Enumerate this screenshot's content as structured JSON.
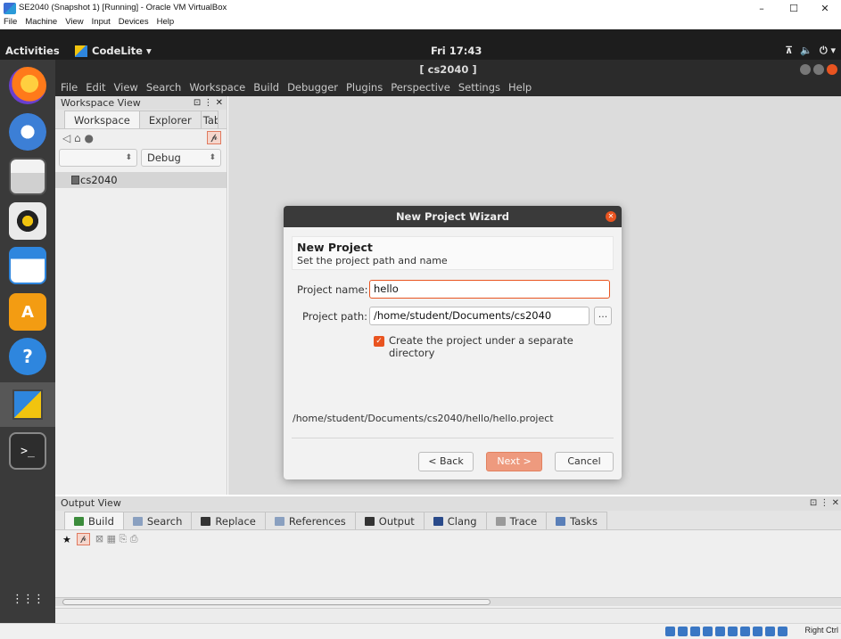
{
  "host": {
    "title": "SE2040 (Snapshot 1) [Running] - Oracle VM VirtualBox",
    "menu": [
      "File",
      "Machine",
      "View",
      "Input",
      "Devices",
      "Help"
    ],
    "minimize": "–",
    "maximize": "☐",
    "close": "✕"
  },
  "topbar": {
    "activities": "Activities",
    "app": "CodeLite ▾",
    "clock": "Fri 17:43",
    "tray": [
      "⊼",
      "🔈",
      "⏻ ▾"
    ]
  },
  "dock": {
    "items": [
      "firefox",
      "thunderbird",
      "files",
      "rhythmbox",
      "writer",
      "software",
      "help",
      "codelite",
      "terminal"
    ],
    "help_glyph": "?",
    "terminal_glyph": ">_",
    "apps_glyph": "⋮⋮⋮"
  },
  "codelite": {
    "title": "[ cs2040 ]",
    "menu": [
      "File",
      "Edit",
      "View",
      "Search",
      "Workspace",
      "Build",
      "Debugger",
      "Plugins",
      "Perspective",
      "Settings",
      "Help"
    ]
  },
  "workspace": {
    "header": "Workspace View",
    "header_btns": "⊡ ⋮ ✕",
    "tabs": [
      "Workspace",
      "Explorer",
      "Tab"
    ],
    "tool_icons": "◁ ⌂ ●",
    "link_glyph": "𝓹",
    "config": "Debug",
    "project": "cs2040"
  },
  "output": {
    "header": "Output View",
    "header_btns": "⊡ ⋮ ✕",
    "tabs": [
      "Build",
      "Search",
      "Replace",
      "References",
      "Output",
      "Clang",
      "Trace",
      "Tasks"
    ],
    "tab_colors": [
      "#3c8c3c",
      "#8aa0c0",
      "#333333",
      "#8aa0c0",
      "#333333",
      "#2a4a8a",
      "#9a9a9a",
      "#5a7fb8"
    ],
    "pin_glyph": "★",
    "link_glyph": "𝓹",
    "tool_icons": "⊠ ▦ ⎘ ⎙"
  },
  "dialog": {
    "title": "New Project Wizard",
    "close_glyph": "✕",
    "heading": "New Project",
    "subheading": "Set the project path and name",
    "name_label": "Project name:",
    "name_value": "hello",
    "path_label": "Project path:",
    "path_value": "/home/student/Documents/cs2040",
    "browse": "...",
    "checkbox_glyph": "✓",
    "checkbox_label": "Create the project under a separate directory",
    "checkbox_checked": true,
    "result_path": "/home/student/Documents/cs2040/hello/hello.project",
    "back": "< Back",
    "next": "Next >",
    "cancel": "Cancel"
  },
  "taskbar": {
    "right_ctrl": "Right Ctrl"
  },
  "colors": {
    "accent": "#e95420",
    "dock_bg": "#3a3a3a",
    "topbar_bg": "#1d1d1d"
  }
}
